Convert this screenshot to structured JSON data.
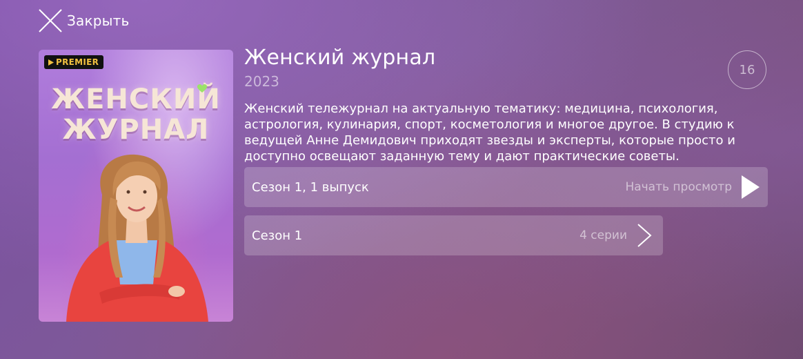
{
  "header": {
    "close_label": "Закрыть"
  },
  "poster": {
    "badge": "PREMIER",
    "title_line1": "ЖЕНСКИЙ",
    "title_line2": "ЖУРНАЛ",
    "colors": {
      "background": "#a46fd2",
      "jacket": "#e8443f",
      "title_text": "#f6e6d6",
      "badge_text": "#f0c040"
    }
  },
  "show": {
    "title": "Женский журнал",
    "year": "2023",
    "age_rating": "16",
    "description": "Женский тележурнал на актуальную тематику: медицина, психология, астрология, кулинария, спорт, косметология и многое другое. В студию к ведущей Анне Демидович приходят звезды и эксперты, которые просто и доступно освещают заданную тему и дают практические советы."
  },
  "actions": {
    "episode": {
      "label": "Сезон 1, 1 выпуск",
      "action_text": "Начать просмотр",
      "icon": "play-icon"
    },
    "season": {
      "label": "Сезон 1",
      "count_text": "4 серии",
      "icon": "chevron-right-icon"
    }
  }
}
